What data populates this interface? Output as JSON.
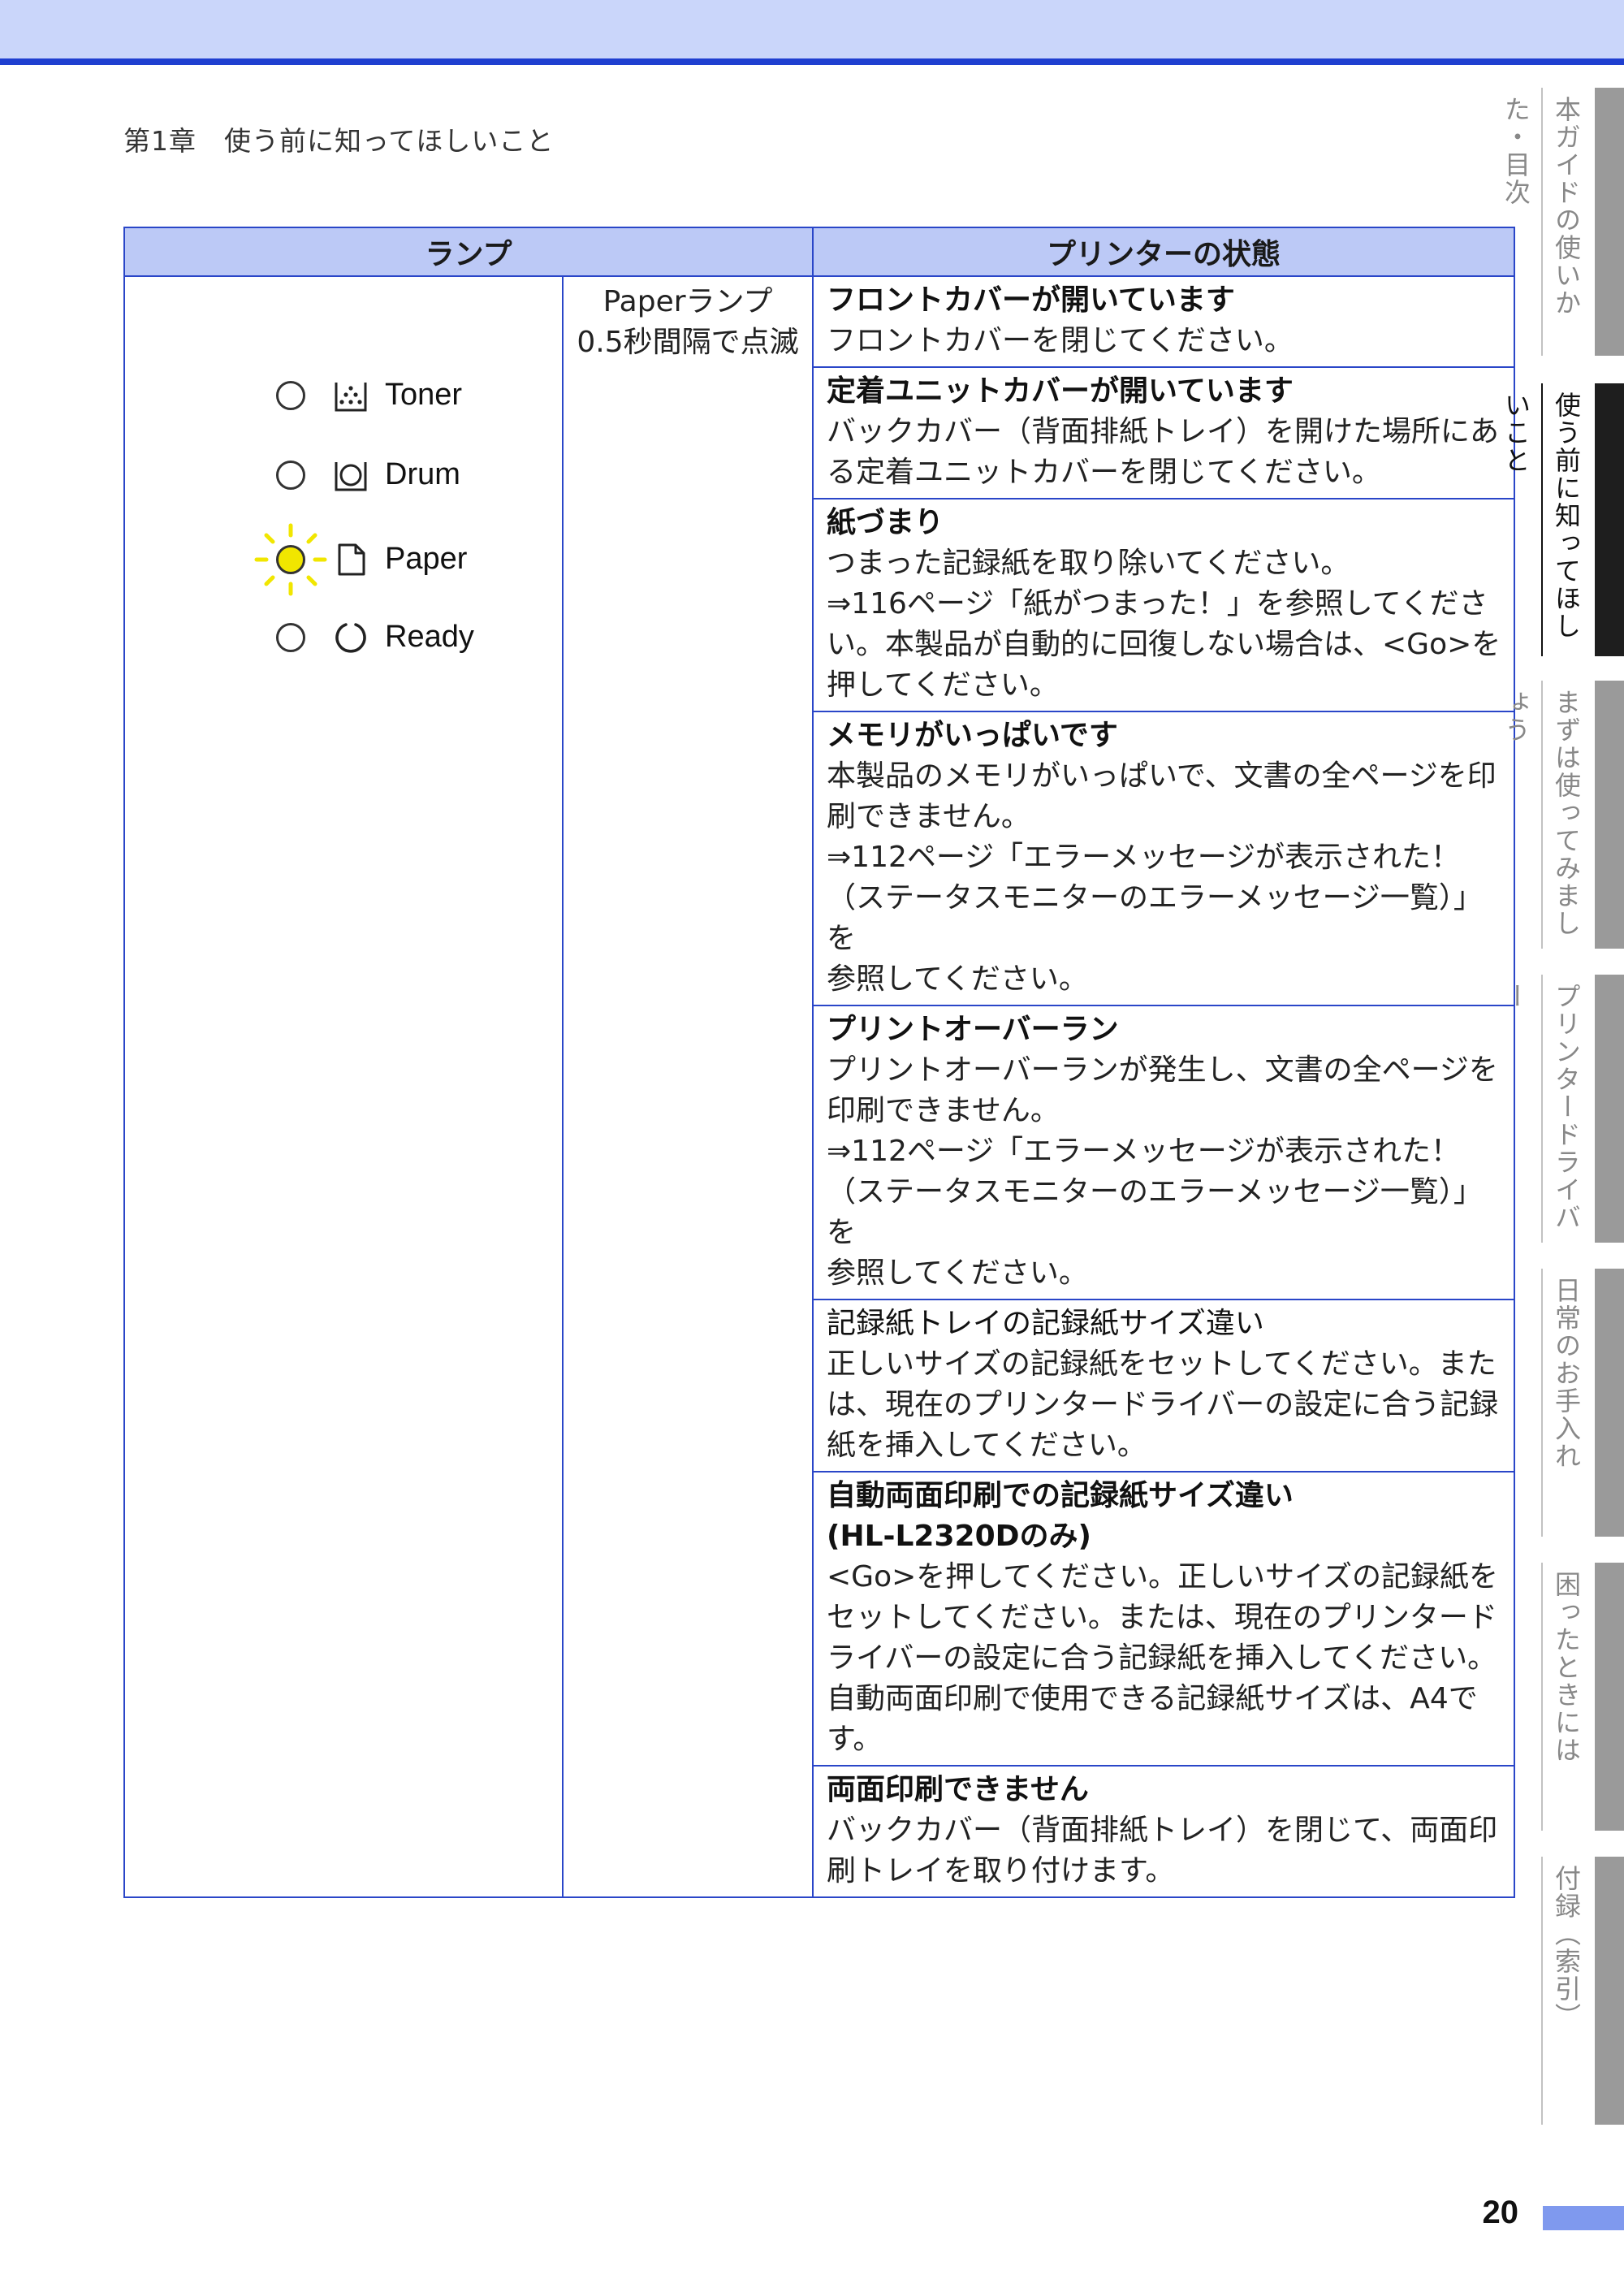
{
  "chapter_heading": "第1章　使う前に知ってほしいこと",
  "table": {
    "header_lamp": "ランプ",
    "header_status": "プリンターの状態",
    "mode_line1": "Paperランプ",
    "mode_line2": "0.5秒間隔で点滅",
    "lamps": [
      {
        "label": "Toner",
        "icon": "toner-icon",
        "state": "off"
      },
      {
        "label": "Drum",
        "icon": "drum-icon",
        "state": "off"
      },
      {
        "label": "Paper",
        "icon": "paper-icon",
        "state": "blinking"
      },
      {
        "label": "Ready",
        "icon": "ready-icon",
        "state": "off"
      }
    ],
    "rows": [
      {
        "title": "フロントカバーが開いています",
        "body": [
          "フロントカバーを閉じてください。"
        ]
      },
      {
        "title": "定着ユニットカバーが開いています",
        "body": [
          "バックカバー（背面排紙トレイ）を開けた場所にあ",
          "る定着ユニットカバーを閉じてください。"
        ]
      },
      {
        "title": "紙づまり",
        "body": [
          "つまった記録紙を取り除いてください。",
          "⇒116ページ「紙がつまった！」を参照してくださ",
          "い。本製品が自動的に回復しない場合は、<Go>を",
          "押してください。"
        ]
      },
      {
        "title": "メモリがいっぱいです",
        "body": [
          "本製品のメモリがいっぱいで、文書の全ページを印",
          "刷できません。",
          "⇒112ページ「エラーメッセージが表示された！",
          "（ステータスモニターのエラーメッセージ一覧）」を",
          "参照してください。"
        ]
      },
      {
        "title": "プリントオーバーラン",
        "body": [
          "プリントオーバーランが発生し、文書の全ページを",
          "印刷できません。",
          "⇒112ページ「エラーメッセージが表示された！",
          "（ステータスモニターのエラーメッセージ一覧）」を",
          "参照してください。"
        ]
      },
      {
        "title": "記録紙トレイの記録紙サイズ違い",
        "body": [
          "正しいサイズの記録紙をセットしてください。また",
          "は、現在のプリンタードライバーの設定に合う記録",
          "紙を挿入してください。"
        ]
      },
      {
        "title": "自動両面印刷での記録紙サイズ違い",
        "body": [
          "(HL-L2320Dのみ)",
          "<Go>を押してください。正しいサイズの記録紙を",
          "セットしてください。または、現在のプリンタード",
          "ライバーの設定に合う記録紙を挿入してください。",
          "自動両面印刷で使用できる記録紙サイズは、A4で",
          "す。"
        ]
      },
      {
        "title": "両面印刷できません",
        "body": [
          "バックカバー（背面排紙トレイ）を閉じて、両面印",
          "刷トレイを取り付けます。"
        ]
      }
    ]
  },
  "side_tabs": [
    {
      "label": "本ガイドの使いかた・目次",
      "active": false
    },
    {
      "label": "使う前に知ってほしいこと",
      "active": true
    },
    {
      "label": "まずは使ってみましょう",
      "active": false
    },
    {
      "label": "プリンタードライバー",
      "active": false
    },
    {
      "label": "日常のお手入れ",
      "active": false
    },
    {
      "label": "困ったときには",
      "active": false
    },
    {
      "label": "付録（索引）",
      "active": false
    }
  ],
  "page_number": "20",
  "colors": {
    "accent": "#1f3fd0",
    "header_band": "#cad6fa",
    "table_header": "#bcc9f6",
    "led_on": "#f1e600"
  }
}
